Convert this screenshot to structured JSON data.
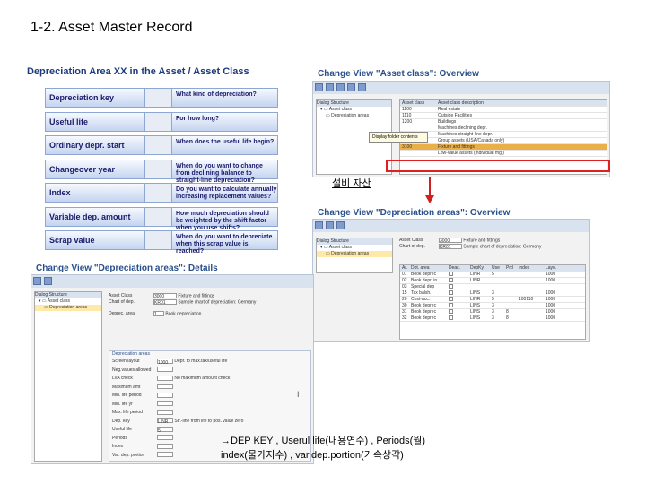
{
  "slide_title": "1-2. Asset Master Record",
  "left_panel": {
    "title": "Depreciation Area XX in the Asset / Asset Class",
    "rows": [
      {
        "key": "Depreciation key",
        "question": "What kind of depreciation?"
      },
      {
        "key": "Useful life",
        "question": "For how long?"
      },
      {
        "key": "Ordinary depr. start",
        "question": "When does the useful life begin?"
      },
      {
        "key": "Changeover year",
        "question": "When do you want to change from declining balance to straight-line depreciation?"
      },
      {
        "key": "Index",
        "question": "Do you want to calculate annually increasing replacement values?"
      },
      {
        "key": "Variable dep. amount",
        "question": "How much depreciation should be weighted by the shift factor when you use shifts?"
      },
      {
        "key": "Scrap value",
        "question": "When do you want to depreciate when this scrap value is reached?"
      }
    ]
  },
  "asset_class_overview": {
    "title": "Change View \"Asset class\": Overview",
    "tree_header": "Dialog Structure",
    "tree_items": [
      "Asset class",
      "Depreciation areas"
    ],
    "popup": "Display folder contents",
    "columns": [
      "Asset class",
      "Asset class description"
    ],
    "rows": [
      [
        "1100",
        "Real estate"
      ],
      [
        "1110",
        "Outside Facilities"
      ],
      [
        "1200",
        "Buildings"
      ],
      [
        "",
        "Machines declining depr."
      ],
      [
        "",
        "Machines straight-line depr."
      ],
      [
        "2200",
        "Group assets (USA/Canada only)"
      ],
      [
        "3100",
        "Fixture and fittings"
      ],
      [
        "",
        "Low-value assets (individual mgt)"
      ]
    ],
    "highlight_index": 6
  },
  "korean_label": "설비 자산",
  "dep_areas_overview": {
    "title": "Change View \"Depreciation areas\": Overview",
    "tree_header": "Dialog Structure",
    "tree_items": [
      "Asset class",
      "Depreciation areas"
    ],
    "fields": [
      {
        "label": "Asset Class",
        "value": "3000",
        "desc": "Fixture and fittings"
      },
      {
        "label": "Chart of dep.",
        "value": "KR01",
        "desc": "Sample chart of depreciation: Germany"
      }
    ],
    "columns": [
      "Ar.",
      "Dpt. area",
      "Deac.",
      "DepKy",
      "Use",
      "Prd",
      "Index",
      "Layo."
    ],
    "rows": [
      [
        "01",
        "Book deprec",
        "",
        "LINR",
        "5",
        "",
        "",
        "1000"
      ],
      [
        "02",
        "Book depr. in",
        "",
        "LINR",
        "",
        "",
        "",
        "1000"
      ],
      [
        "03",
        "Special dep",
        "",
        "",
        "",
        "",
        "",
        ""
      ],
      [
        "15",
        "Tax balsh.",
        "",
        "LINS",
        "3",
        "",
        "",
        "1000"
      ],
      [
        "20",
        "Cost-acc.",
        "",
        "LINR",
        "5",
        "",
        "100110",
        "1000"
      ],
      [
        "30",
        "Book deprec",
        "",
        "LINS",
        "3",
        "",
        "",
        "1000"
      ],
      [
        "31",
        "Book deprec",
        "",
        "LINS",
        "3",
        "8",
        "",
        "1000"
      ],
      [
        "32",
        "Book deprec",
        "",
        "LINS",
        "3",
        "8",
        "",
        "1000"
      ]
    ]
  },
  "dep_areas_details": {
    "title": "Change View \"Depreciation areas\": Details",
    "tree_header": "Dialog Structure",
    "tree_items": [
      "Asset class",
      "Depreciation areas"
    ],
    "fields": [
      {
        "label": "Asset Class",
        "value": "3000",
        "desc": "Fixture and fittings"
      },
      {
        "label": "Chart of dep.",
        "value": "KR01",
        "desc": "Sample chart of depreciation: Germany"
      },
      {
        "label": "Deprec. area",
        "value": "1",
        "desc": "Book depreciation"
      }
    ],
    "section": "Depreciation areas",
    "detail_rows": [
      {
        "label": "Screen layout",
        "value": "1000",
        "desc": "Depr. to max.tax/useful life"
      },
      {
        "label": "Neg.values allowed",
        "value": "",
        "desc": ""
      },
      {
        "label": "LVA check",
        "value": "",
        "desc": "No maximum amount check"
      },
      {
        "label": "Maximum amt",
        "value": "",
        "desc": ""
      },
      {
        "label": "Min. life period",
        "value": "",
        "desc": ""
      },
      {
        "label": "Min. life yr",
        "value": "",
        "desc": ""
      },
      {
        "label": "Max. life period",
        "value": "",
        "desc": ""
      },
      {
        "label": "Dep. key",
        "value": "LINR",
        "desc": "Str.-line from life to pos. value zero"
      },
      {
        "label": "Useful life",
        "value": "5",
        "desc": ""
      },
      {
        "label": "Periods",
        "value": "",
        "desc": ""
      },
      {
        "label": "Index",
        "value": "",
        "desc": ""
      },
      {
        "label": "Var. dep. portion",
        "value": "",
        "desc": ""
      }
    ]
  },
  "footnote": {
    "line1": "→DEP KEY , Userul life(내용연수) , Periods(월)",
    "line2": "index(물가지수) , var.dep.portion(가속상각)"
  }
}
